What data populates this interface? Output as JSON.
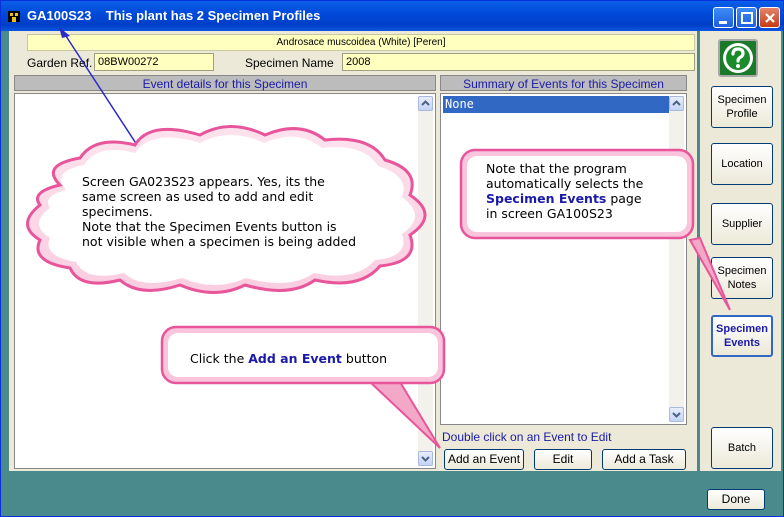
{
  "window": {
    "title": "GA100S23    This plant has 2 Specimen Profiles"
  },
  "plant": {
    "species": "Androsace muscoidea (White) [Peren]"
  },
  "fields": {
    "garden_ref_label": "Garden Ref.",
    "garden_ref_value": "08BW00272",
    "specimen_name_label": "Specimen Name",
    "specimen_name_value": "2008"
  },
  "panels": {
    "event_details_header": "Event details for this Specimen",
    "summary_header": "Summary of Events for this Specimen",
    "summary_items": [
      "None"
    ],
    "hint": "Double click on an Event to Edit"
  },
  "buttons": {
    "add_event": "Add an Event",
    "edit": "Edit",
    "add_task": "Add a Task",
    "done": "Done"
  },
  "sidebar": {
    "items": [
      {
        "label_line1": "Specimen",
        "label_line2": "Profile"
      },
      {
        "label_line1": "Location",
        "label_line2": ""
      },
      {
        "label_line1": "Supplier",
        "label_line2": ""
      },
      {
        "label_line1": "Specimen",
        "label_line2": "Notes"
      },
      {
        "label_line1": "Specimen",
        "label_line2": "Events"
      },
      {
        "label_line1": "Batch",
        "label_line2": ""
      }
    ]
  },
  "annotations": {
    "cloud_line1": "Screen GA023S23 appears. Yes, its the",
    "cloud_line2": "same screen as used to add and edit",
    "cloud_line3": "specimens.",
    "cloud_line4": "Note that the Specimen Events button is",
    "cloud_line5": "not visible when a specimen is being added",
    "callout_right_line1": "Note that the program",
    "callout_right_line2": "automatically selects the",
    "callout_right_bold": "Specimen Events",
    "callout_right_line3_rest": " page",
    "callout_right_line4": "in screen GA100S23",
    "callout_bottom_prefix": "Click the ",
    "callout_bottom_bold": "Add an Event",
    "callout_bottom_suffix": " button"
  },
  "colors": {
    "accent_blue": "#1a1aa8",
    "callout_pink": "#e8559a",
    "selection": "#3168c4"
  }
}
